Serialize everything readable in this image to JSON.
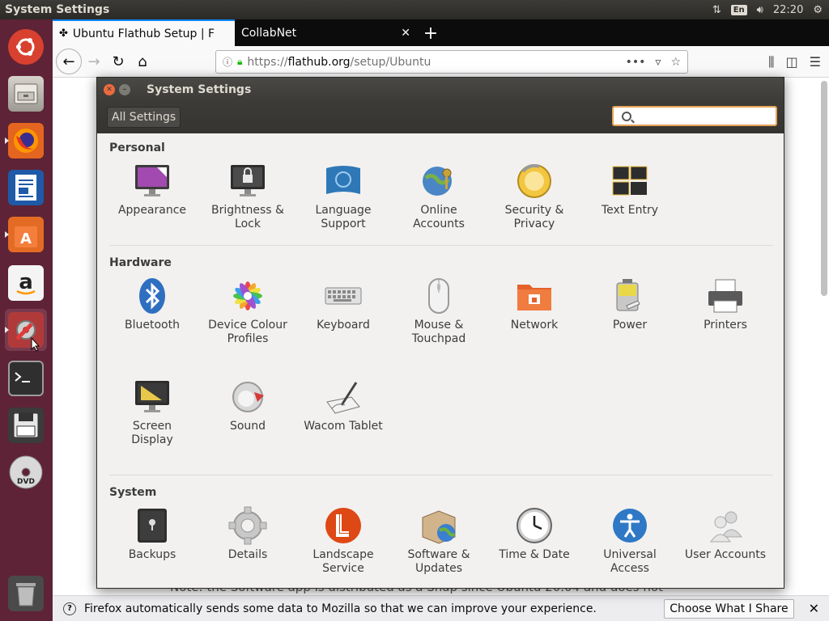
{
  "top_panel": {
    "title": "System Settings",
    "keyboard_layout": "En",
    "clock": "22:20"
  },
  "launcher": {
    "items": [
      {
        "name": "ubuntu-dash"
      },
      {
        "name": "files"
      },
      {
        "name": "firefox"
      },
      {
        "name": "libreoffice-writer"
      },
      {
        "name": "software-center"
      },
      {
        "name": "amazon"
      },
      {
        "name": "system-settings"
      },
      {
        "name": "terminal"
      },
      {
        "name": "save-disk"
      },
      {
        "name": "dvd"
      },
      {
        "name": "trash"
      }
    ]
  },
  "browser": {
    "tabs": [
      {
        "label": "Ubuntu Flathub Setup | F",
        "active": true
      },
      {
        "label": "CollabNet",
        "active": false
      }
    ],
    "url_prefix": "https://",
    "url_host": "flathub.org",
    "url_path": "/setup/Ubuntu",
    "page_note": "Note: the Software app is distributed as a Snap since Ubuntu 20.04 and does not",
    "notification": {
      "text": "Firefox automatically sends some data to Mozilla so that we can improve your experience.",
      "button": "Choose What I Share"
    }
  },
  "dialog": {
    "title": "System Settings",
    "all_settings": "All Settings",
    "search_placeholder": "",
    "sections": {
      "personal": {
        "title": "Personal",
        "items": [
          {
            "label": "Appearance"
          },
          {
            "label": "Brightness &\nLock"
          },
          {
            "label": "Language\nSupport"
          },
          {
            "label": "Online\nAccounts"
          },
          {
            "label": "Security &\nPrivacy"
          },
          {
            "label": "Text Entry"
          }
        ]
      },
      "hardware": {
        "title": "Hardware",
        "items": [
          {
            "label": "Bluetooth"
          },
          {
            "label": "Device Colour\nProfiles"
          },
          {
            "label": "Keyboard"
          },
          {
            "label": "Mouse &\nTouchpad"
          },
          {
            "label": "Network"
          },
          {
            "label": "Power"
          },
          {
            "label": "Printers"
          },
          {
            "label": "Screen\nDisplay"
          },
          {
            "label": "Sound"
          },
          {
            "label": "Wacom Tablet"
          }
        ]
      },
      "system": {
        "title": "System",
        "items": [
          {
            "label": "Backups"
          },
          {
            "label": "Details"
          },
          {
            "label": "Landscape\nService"
          },
          {
            "label": "Software &\nUpdates"
          },
          {
            "label": "Time & Date"
          },
          {
            "label": "Universal\nAccess"
          },
          {
            "label": "User Accounts"
          }
        ]
      }
    }
  },
  "colors": {
    "launcher_bg": "#5e2336",
    "panel_bg": "#2b2a27",
    "accent_orange": "#e5a356",
    "close_btn": "#ec6a3f"
  }
}
